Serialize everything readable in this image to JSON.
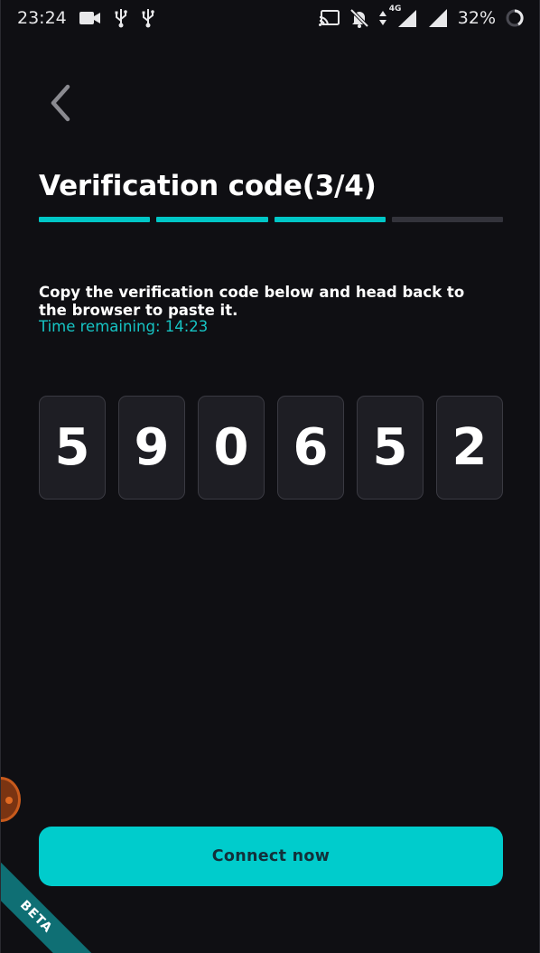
{
  "status_bar": {
    "time": "23:24",
    "battery_percent": "32%",
    "network_type": "4G",
    "left_icons": [
      "video-camera-icon",
      "usb-icon",
      "usb-icon"
    ],
    "right_icons": [
      "cast-icon",
      "notifications-off-icon",
      "data-arrows-icon",
      "signal-4g-icon",
      "signal-icon",
      "battery-ring-icon"
    ]
  },
  "header": {
    "back_icon": "chevron-left-icon",
    "title": "Verification code(3/4)"
  },
  "progress": {
    "current_step": 3,
    "total_steps": 4
  },
  "instruction": {
    "text": "Copy the verification code below and head back to the browser to paste it.",
    "time_remaining": "Time remaining: 14:23"
  },
  "code": {
    "digits": [
      "5",
      "9",
      "0",
      "6",
      "5",
      "2"
    ]
  },
  "actions": {
    "connect_label": "Connect now"
  },
  "badge": {
    "label": "BETA"
  },
  "colors": {
    "background": "#0f0f13",
    "accent": "#00cccc",
    "progress_inactive": "#33333b",
    "digit_box": "#1e1e24",
    "timer_text": "#16c4c4",
    "beta_ribbon": "#0f6f74"
  }
}
